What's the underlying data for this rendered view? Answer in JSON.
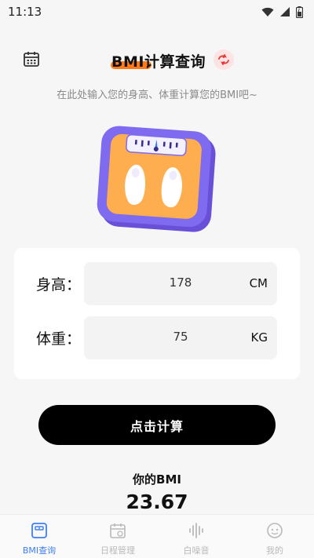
{
  "status_bar": {
    "time": "11:13",
    "icons": [
      "wifi-icon",
      "cell-signal-icon",
      "battery-icon"
    ]
  },
  "header": {
    "title": "BMI计算查询",
    "left_icon": "calendar-icon",
    "right_icon": "refresh-icon",
    "accent_color": "#ff7a1a"
  },
  "subtitle": "在此处输入您的身高、体重计算您的BMI吧~",
  "illustration": "bathroom-scale-icon",
  "form": {
    "height": {
      "label": "身高：",
      "value": "178",
      "unit": "CM"
    },
    "weight": {
      "label": "体重：",
      "value": "75",
      "unit": "KG"
    }
  },
  "calc_button_label": "点击计算",
  "result": {
    "label": "你的BMI",
    "value": "23.67"
  },
  "tabs": [
    {
      "label": "BMI查询",
      "icon": "scale-tab-icon",
      "active": true
    },
    {
      "label": "日程管理",
      "icon": "calendar-tab-icon",
      "active": false
    },
    {
      "label": "白噪音",
      "icon": "soundwave-tab-icon",
      "active": false
    },
    {
      "label": "我的",
      "icon": "profile-tab-icon",
      "active": false
    }
  ],
  "colors": {
    "active_tab": "#3f7ff0",
    "inactive_tab": "#b9b9b9",
    "scale_body": "#ffae4f",
    "scale_frame": "#7b68ee"
  }
}
